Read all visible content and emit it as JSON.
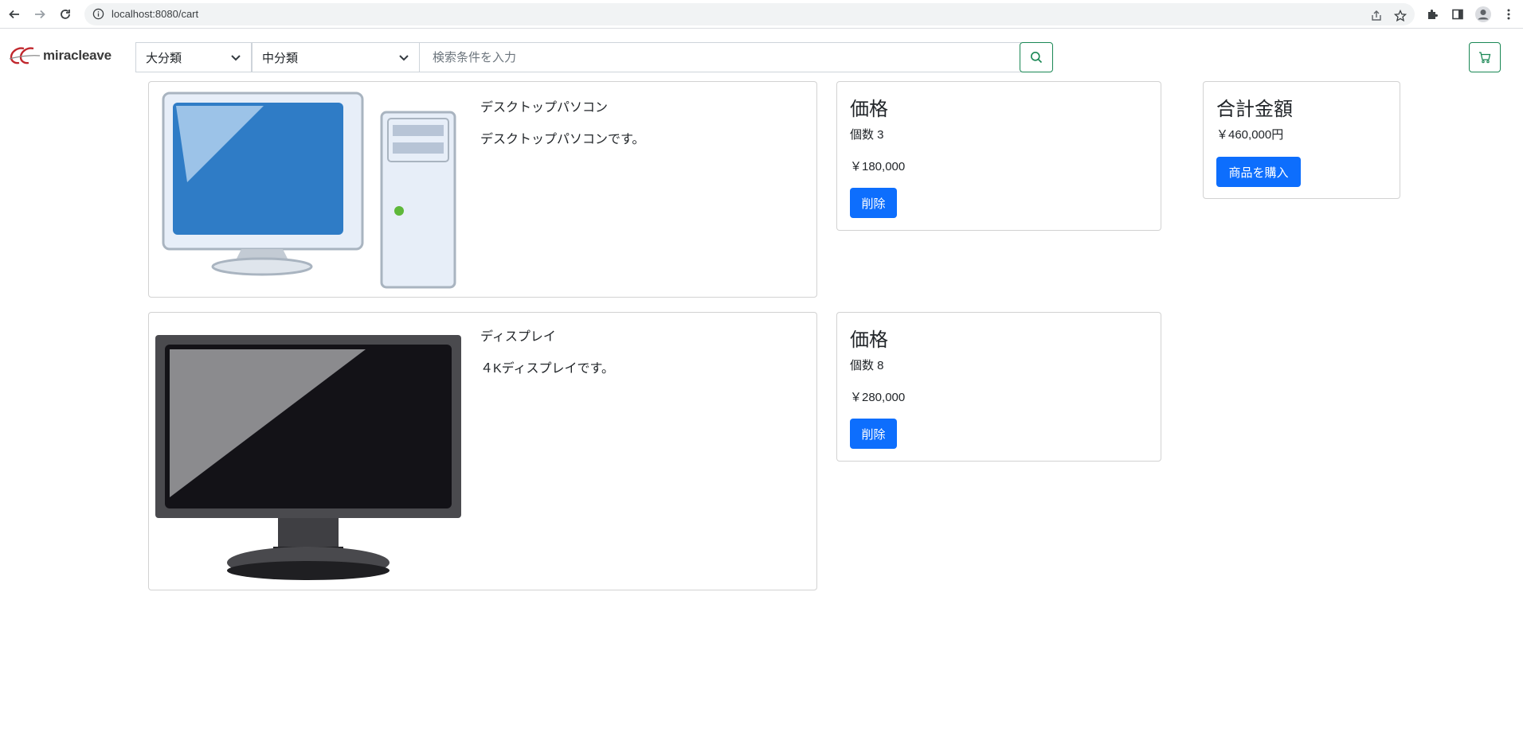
{
  "browser": {
    "url": "localhost:8080/cart"
  },
  "header": {
    "logo_text": "miracleave",
    "category_large": "大分類",
    "category_medium": "中分類",
    "search_placeholder": "検索条件を入力"
  },
  "cart": {
    "items": [
      {
        "name": "デスクトップパソコン",
        "description": "デスクトップパソコンです。",
        "price_heading": "価格",
        "quantity": "個数 3",
        "price": "￥180,000",
        "delete_label": "削除"
      },
      {
        "name": "ディスプレイ",
        "description": "４Kディスプレイです。",
        "price_heading": "価格",
        "quantity": "個数 8",
        "price": "￥280,000",
        "delete_label": "削除"
      }
    ],
    "summary": {
      "heading": "合計金額",
      "total": "￥460,000円",
      "purchase_label": "商品を購入"
    }
  },
  "icons": {
    "back": "arrow-left-icon",
    "forward": "arrow-right-icon",
    "reload": "reload-icon",
    "info": "info-icon",
    "share": "share-icon",
    "bookmark": "star-icon",
    "extensions": "puzzle-icon",
    "sidepanel": "side-panel-icon",
    "profile": "profile-icon",
    "menu": "kebab-menu-icon",
    "search": "search-icon",
    "cart": "cart-icon"
  },
  "colors": {
    "primary": "#0d6efd",
    "success_outline": "#198754"
  }
}
